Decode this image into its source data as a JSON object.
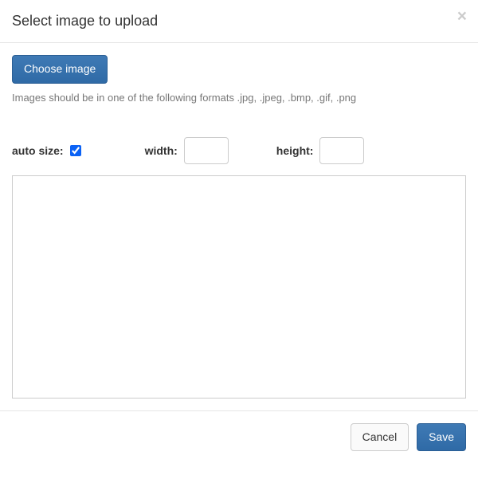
{
  "header": {
    "title": "Select image to upload",
    "close_label": "×"
  },
  "body": {
    "choose_button": "Choose image",
    "help_text": "Images should be in one of the following formats .jpg, .jpeg, .bmp, .gif, .png",
    "auto_size_label": "auto size:",
    "auto_size_checked": true,
    "width_label": "width:",
    "width_value": "",
    "height_label": "height:",
    "height_value": ""
  },
  "footer": {
    "cancel": "Cancel",
    "save": "Save"
  }
}
